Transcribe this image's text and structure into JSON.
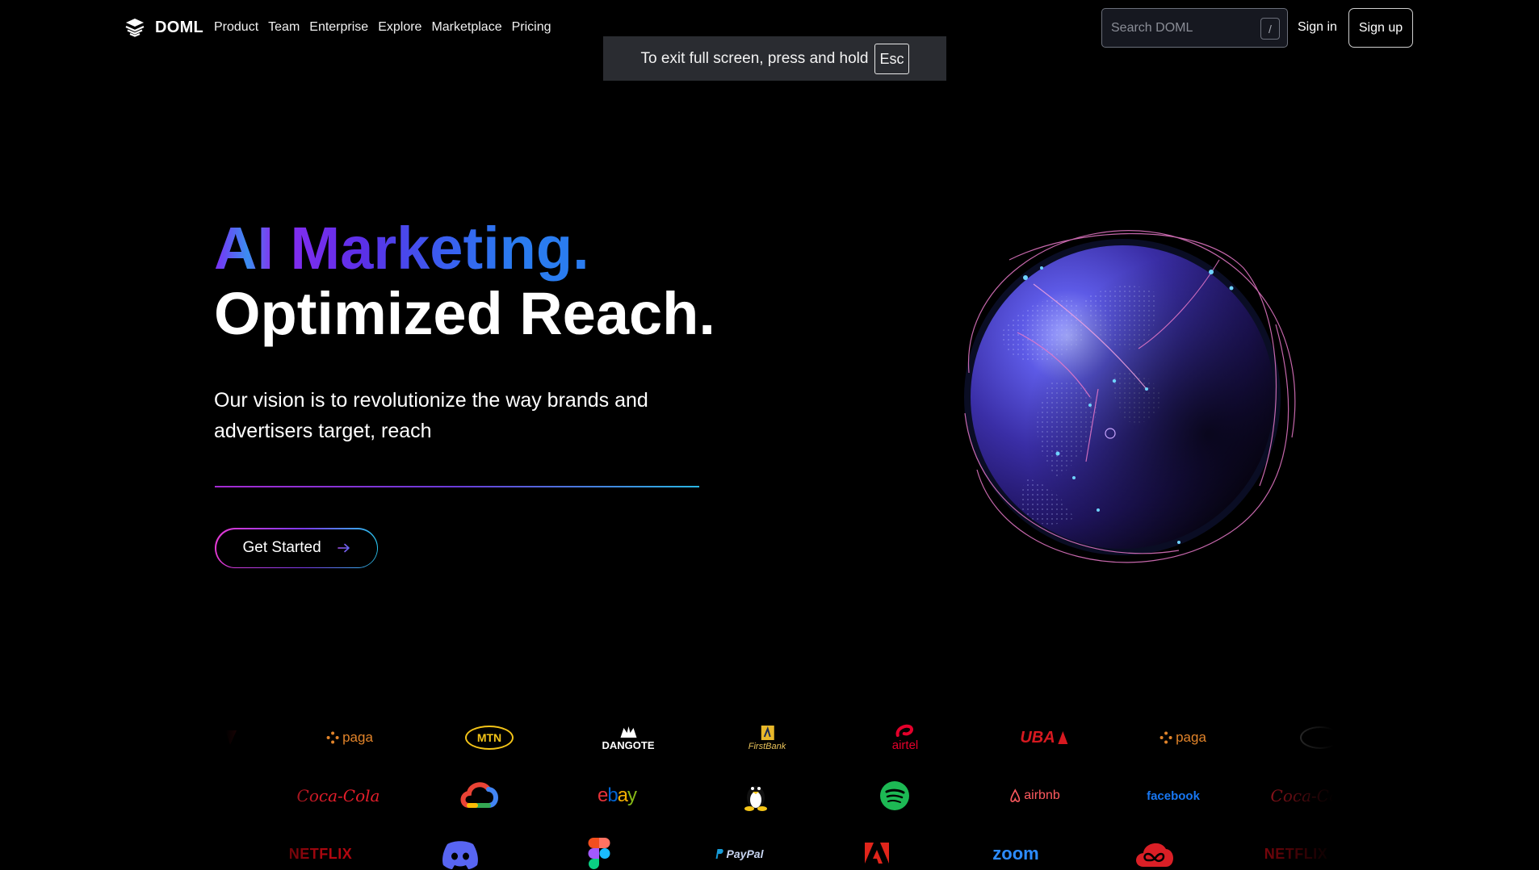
{
  "header": {
    "brand": "DOML",
    "nav": [
      "Product",
      "Team",
      "Enterprise",
      "Explore",
      "Marketplace",
      "Pricing"
    ],
    "search_placeholder": "Search DOML",
    "search_shortcut": "/",
    "sign_in": "Sign in",
    "sign_up": "Sign up"
  },
  "fullscreen_toast": {
    "message": "To exit full screen, press and hold",
    "key": "Esc"
  },
  "hero": {
    "headline_1": "AI Marketing.",
    "headline_2": "Optimized Reach.",
    "subtitle": "Our vision is to revolutionize the way brands and advertisers target, reach",
    "cta_label": "Get Started"
  },
  "logos": {
    "row1": [
      "paga",
      "MTN",
      "DANGOTE",
      "FirstBank",
      "airtel",
      "UBA",
      "paga"
    ],
    "row2": [
      "Coca-Cola",
      "google-cloud-icon",
      "ebay",
      "linux-icon",
      "spotify-icon",
      "airbnb",
      "facebook",
      "Coca-Cola"
    ],
    "row3": [
      "NETFLIX",
      "discord-icon",
      "figma-icon",
      "PayPal",
      "adobe-icon",
      "zoom",
      "creative-cloud-icon",
      "NETFLIX"
    ]
  },
  "colors": {
    "background": "#000000",
    "gradient_purple": "#7c2cf5",
    "gradient_blue": "#2a7cf0",
    "gradient_pink": "#e43ad3",
    "gradient_cyan": "#29c3ec",
    "paga_orange": "#e2842a",
    "mtn_yellow": "#f5c518",
    "airtel_red": "#e4002b",
    "uba_red": "#d71920",
    "cocacola_red": "#e41e2b",
    "spotify_green": "#1db954",
    "facebook_blue": "#1877f2",
    "netflix_red": "#b20710",
    "discord_blue": "#5865f2",
    "zoom_blue": "#2d8cff"
  }
}
